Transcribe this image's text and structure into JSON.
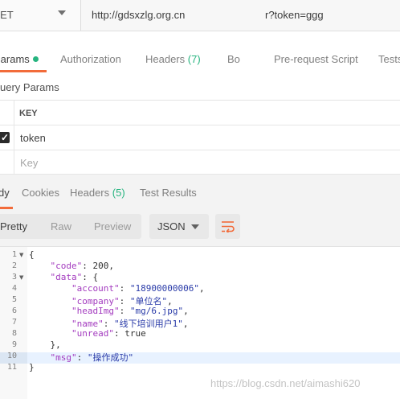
{
  "request": {
    "method": "GET",
    "url": "http://gdsxzlg.org.cn",
    "url_tail": "r?token=ggg"
  },
  "request_tabs": {
    "params": "Params",
    "authorization": "Authorization",
    "headers": "Headers",
    "headers_count": "(7)",
    "body": "Bo",
    "pre_request_script": "Pre-request Script",
    "tests": "Tests"
  },
  "query_params": {
    "title": "uery Params",
    "key_header": "KEY",
    "rows": [
      {
        "checked": true,
        "key": "token"
      }
    ],
    "key_placeholder": "Key"
  },
  "response_tabs": {
    "body": "dy",
    "cookies": "Cookies",
    "headers": "Headers",
    "headers_count": "(5)",
    "test_results": "Test Results"
  },
  "response_toolbar": {
    "pretty": "Pretty",
    "raw": "Raw",
    "preview": "Preview",
    "format": "JSON"
  },
  "code": {
    "line_numbers": [
      "1",
      "2",
      "3",
      "4",
      "5",
      "6",
      "7",
      "8",
      "9",
      "10",
      "11"
    ],
    "lines": [
      "{",
      "    \"code\": 200,",
      "    \"data\": {",
      "        \"account\": \"18900000006\",",
      "        \"company\": \"单位名\",",
      "        \"headImg\": \"mg/6.jpg\",",
      "        \"name\": \"线下培训用户1\",",
      "        \"unread\": true",
      "    },",
      "    \"msg\": \"操作成功\"",
      "}"
    ]
  },
  "watermark": "https://blog.csdn.net/aimashi620",
  "colors": {
    "accent": "#f26b3a",
    "green": "#26b47f",
    "json_key": "#a33bbf",
    "json_string": "#2a3ba8"
  }
}
